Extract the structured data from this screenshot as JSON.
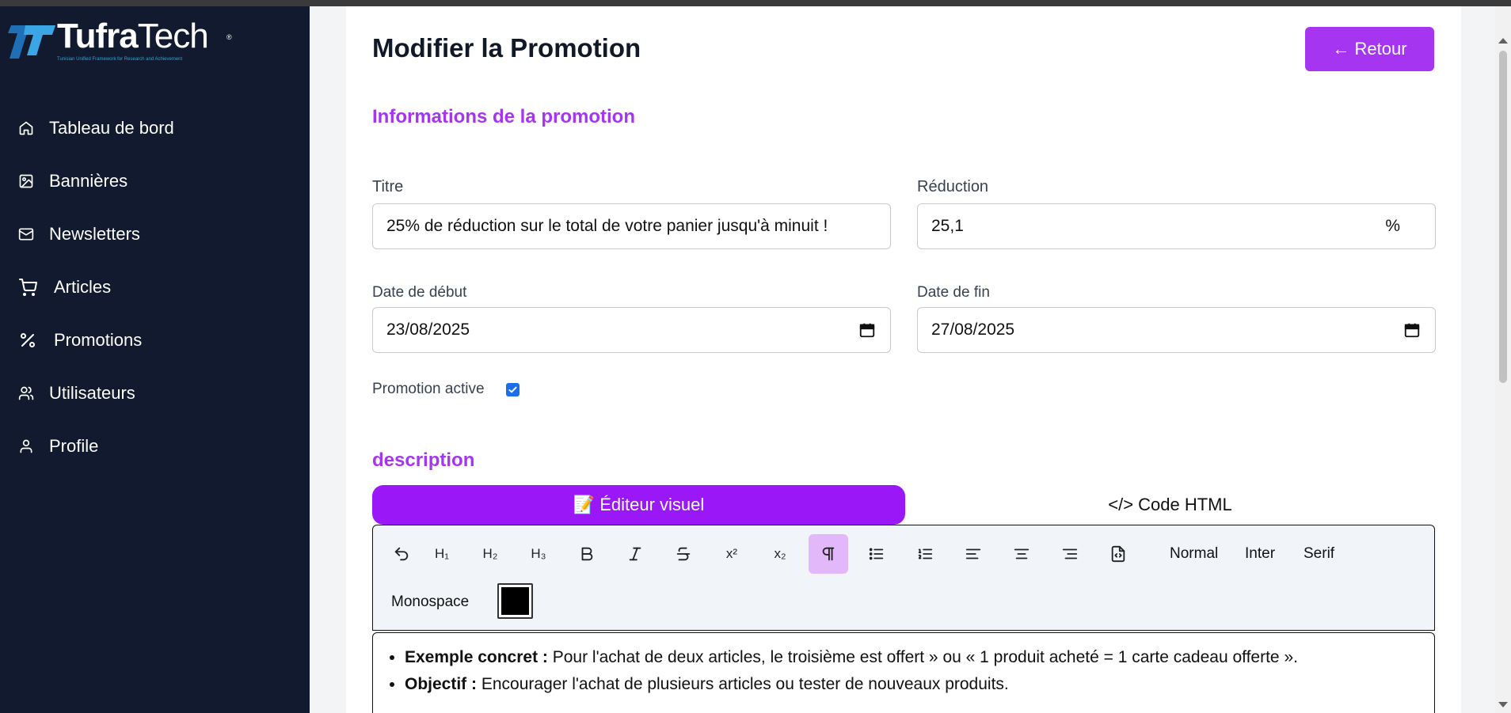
{
  "brand": {
    "name_bold": "Tufra",
    "name_light": "Tech",
    "registered": "®",
    "tagline": "Tunisian Unified Framework for Research and Achievement",
    "accent": "#a535f0"
  },
  "sidebar": {
    "items": [
      {
        "label": "Tableau de bord",
        "icon": "home-icon"
      },
      {
        "label": "Bannières",
        "icon": "image-icon"
      },
      {
        "label": "Newsletters",
        "icon": "mail-icon"
      },
      {
        "label": "Articles",
        "icon": "cart-icon"
      },
      {
        "label": "Promotions",
        "icon": "percent-icon"
      },
      {
        "label": "Utilisateurs",
        "icon": "users-icon"
      },
      {
        "label": "Profile",
        "icon": "user-icon"
      }
    ]
  },
  "page": {
    "title": "Modifier la Promotion",
    "back_label": "← Retour"
  },
  "form": {
    "section_title": "Informations de la promotion",
    "titre_label": "Titre",
    "titre_value": "25% de réduction sur le total de votre panier jusqu'à minuit !",
    "reduction_label": "Réduction",
    "reduction_value": "25,1",
    "reduction_suffix": "%",
    "start_label": "Date de début",
    "start_value": "23/08/2025",
    "end_label": "Date de fin",
    "end_value": "27/08/2025",
    "active_label": "Promotion active",
    "active_checked": true
  },
  "description": {
    "title": "description",
    "tab_visual": "📝 Éditeur visuel",
    "tab_html": "</> Code HTML",
    "toolbar": {
      "h1": "H₁",
      "h2": "H₂",
      "h3": "H₃",
      "superscript": "x²",
      "subscript": "x₂",
      "font_normal": "Normal",
      "font_inter": "Inter",
      "font_serif": "Serif",
      "font_mono": "Monospace",
      "text_color": "#000000"
    },
    "content": [
      {
        "bold": "Exemple concret :",
        "text": " Pour l'achat de deux articles, le troisième est offert » ou « 1 produit acheté = 1 carte cadeau offerte »."
      },
      {
        "bold": "Objectif :",
        "text": " Encourager l'achat de plusieurs articles ou tester de nouveaux produits."
      }
    ]
  }
}
